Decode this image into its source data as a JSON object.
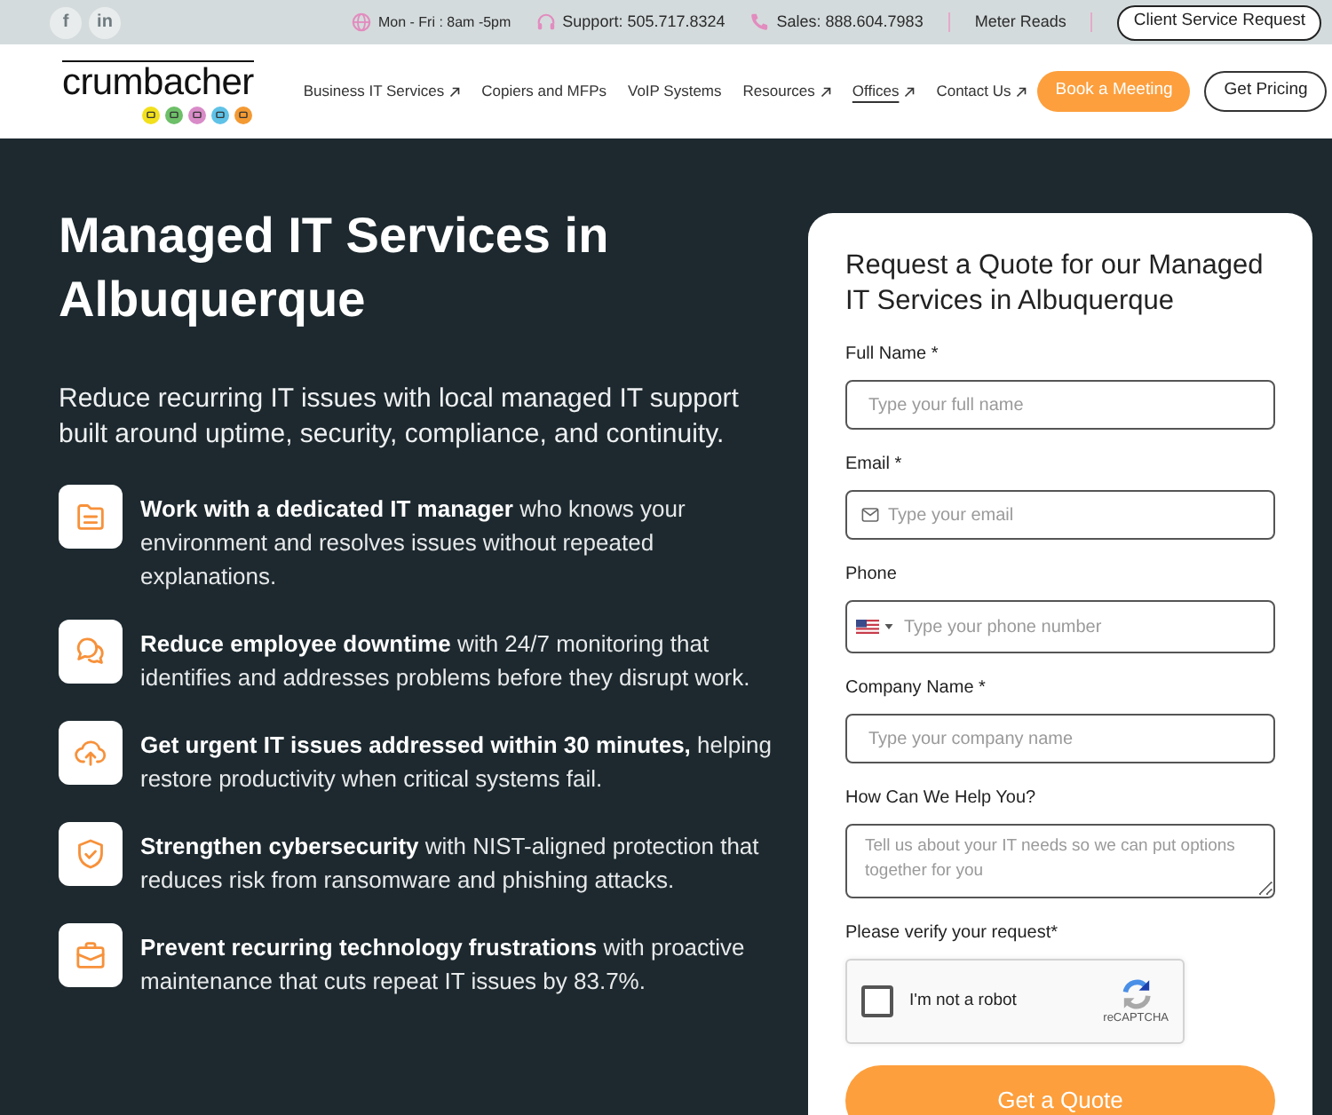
{
  "top_bar": {
    "social_links": [
      "f",
      "in"
    ],
    "contacts": [
      {
        "kind": "hours",
        "text": "Mon - Fri : 8am -5pm"
      },
      {
        "kind": "support",
        "text": "Support: 505.717.8324"
      },
      {
        "kind": "sales",
        "text": "Sales: 888.604.7983"
      }
    ],
    "links": [
      "Meter Reads"
    ],
    "button": "Client Service Request"
  },
  "nav": {
    "logo": "crumbacher",
    "items": [
      {
        "label": "Business IT Services",
        "external": true,
        "selected": false
      },
      {
        "label": "Copiers and MFPs",
        "external": false,
        "selected": false
      },
      {
        "label": "VoIP Systems",
        "external": false,
        "selected": false
      },
      {
        "label": "Resources",
        "external": true,
        "selected": false
      },
      {
        "label": "Offices",
        "external": true,
        "selected": true
      },
      {
        "label": "Contact Us",
        "external": true,
        "selected": false
      }
    ],
    "buttons": [
      {
        "label": "Book a Meeting",
        "kind": "primary"
      },
      {
        "label": "Get Pricing",
        "kind": "outline"
      }
    ]
  },
  "hero": {
    "title": "Managed IT Services in Albuquerque",
    "subtitle": "Reduce recurring IT issues with local managed IT support built around uptime, security, compliance, and continuity.",
    "features": [
      {
        "kind": "folder",
        "text": "**Work with a dedicated IT manager** who knows your environment and resolves issues without repeated explanations."
      },
      {
        "kind": "chat",
        "text": "**Reduce employee downtime** with 24/7 monitoring that identifies and addresses problems before they disrupt work."
      },
      {
        "kind": "cloud-upload",
        "text": "**Get urgent IT issues addressed within 30 minutes,** helping restore productivity when critical systems fail."
      },
      {
        "kind": "shield",
        "text": "**Strengthen cybersecurity** with NIST-aligned protection that reduces risk from ransomware and phishing attacks."
      },
      {
        "kind": "briefcase",
        "text": "**Prevent recurring technology frustrations** with proactive maintenance that cuts repeat IT issues by 83.7%."
      }
    ]
  },
  "form": {
    "title": "Request a Quote for our Managed IT Services in Albuquerque",
    "fields": [
      {
        "kind": "text",
        "label": "Full Name *",
        "placeholder": "Type your full name"
      },
      {
        "kind": "email",
        "label": "Email *",
        "placeholder": "Type your email"
      },
      {
        "kind": "phone",
        "label": "Phone",
        "placeholder": "Type your phone number"
      },
      {
        "kind": "text",
        "label": "Company Name *",
        "placeholder": "Type your company name"
      },
      {
        "kind": "textarea",
        "label": "How Can We Help You?",
        "placeholder": "Tell us about your IT needs so we can put options together for you"
      }
    ],
    "captcha": {
      "label": "Please verify your request*",
      "text": "I'm not a robot",
      "checked": false,
      "brand": "reCAPTCHA"
    },
    "submit": "Get a Quote"
  }
}
